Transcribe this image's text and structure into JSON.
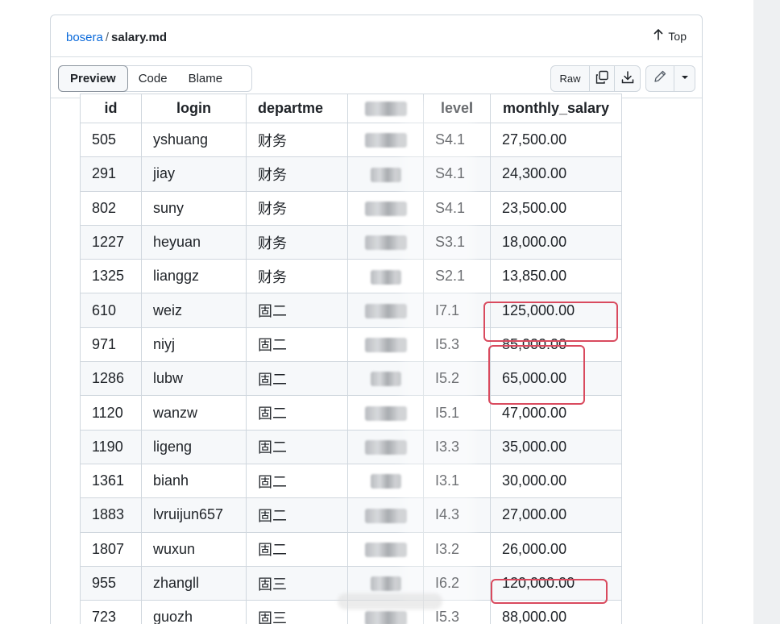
{
  "breadcrumb": {
    "repo": "bosera",
    "separator": "/",
    "file": "salary.md"
  },
  "top_link": "Top",
  "tabs": [
    "Preview",
    "Code",
    "Blame"
  ],
  "active_tab": "Preview",
  "actions": {
    "raw": "Raw",
    "icons": [
      "copy-icon",
      "download-icon",
      "pencil-icon",
      "chevron-down-icon"
    ]
  },
  "table": {
    "headers": [
      "id",
      "login",
      "departme",
      "",
      "level",
      "monthly_salary"
    ],
    "rows": [
      {
        "id": "505",
        "login": "yshuang",
        "department": "财务",
        "level": "S4.1",
        "monthly_salary": "27,500.00"
      },
      {
        "id": "291",
        "login": "jiay",
        "department": "财务",
        "level": "S4.1",
        "monthly_salary": "24,300.00"
      },
      {
        "id": "802",
        "login": "suny",
        "department": "财务",
        "level": "S4.1",
        "monthly_salary": "23,500.00"
      },
      {
        "id": "1227",
        "login": "heyuan",
        "department": "财务",
        "level": "S3.1",
        "monthly_salary": "18,000.00"
      },
      {
        "id": "1325",
        "login": "lianggz",
        "department": "财务",
        "level": "S2.1",
        "monthly_salary": "13,850.00"
      },
      {
        "id": "610",
        "login": "weiz",
        "department": "固二",
        "level": "I7.1",
        "monthly_salary": "125,000.00"
      },
      {
        "id": "971",
        "login": "niyj",
        "department": "固二",
        "level": "I5.3",
        "monthly_salary": "85,000.00"
      },
      {
        "id": "1286",
        "login": "lubw",
        "department": "固二",
        "level": "I5.2",
        "monthly_salary": "65,000.00"
      },
      {
        "id": "1120",
        "login": "wanzw",
        "department": "固二",
        "level": "I5.1",
        "monthly_salary": "47,000.00"
      },
      {
        "id": "1190",
        "login": "ligeng",
        "department": "固二",
        "level": "I3.3",
        "monthly_salary": "35,000.00"
      },
      {
        "id": "1361",
        "login": "bianh",
        "department": "固二",
        "level": "I3.1",
        "monthly_salary": "30,000.00"
      },
      {
        "id": "1883",
        "login": "lvruijun657",
        "department": "固二",
        "level": "I4.3",
        "monthly_salary": "27,000.00"
      },
      {
        "id": "1807",
        "login": "wuxun",
        "department": "固二",
        "level": "I3.2",
        "monthly_salary": "26,000.00"
      },
      {
        "id": "955",
        "login": "zhangll",
        "department": "固三",
        "level": "I6.2",
        "monthly_salary": "120,000.00"
      },
      {
        "id": "723",
        "login": "guozh",
        "department": "固三",
        "level": "I5.3",
        "monthly_salary": "88,000.00"
      }
    ]
  },
  "colors": {
    "link": "#0969da",
    "highlight": "#d94a5e",
    "border": "#d0d7de",
    "zebra": "#f6f8fa"
  }
}
